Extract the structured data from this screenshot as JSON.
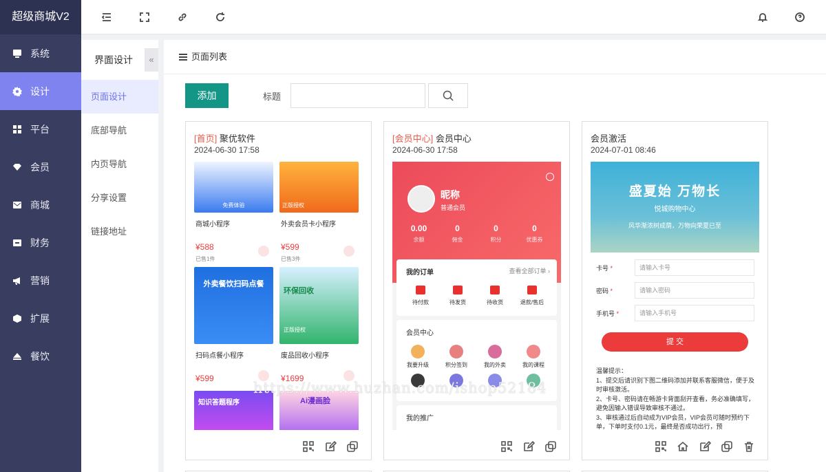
{
  "brand": "超级商城V2",
  "nav": [
    {
      "label": "系统",
      "icon": "monitor-icon",
      "active": false
    },
    {
      "label": "设计",
      "icon": "gear-icon",
      "active": true
    },
    {
      "label": "平台",
      "icon": "grid-icon",
      "active": false
    },
    {
      "label": "会员",
      "icon": "diamond-icon",
      "active": false
    },
    {
      "label": "商城",
      "icon": "mail-icon",
      "active": false
    },
    {
      "label": "财务",
      "icon": "wallet-icon",
      "active": false
    },
    {
      "label": "营销",
      "icon": "megaphone-icon",
      "active": false
    },
    {
      "label": "扩展",
      "icon": "cube-icon",
      "active": false
    },
    {
      "label": "餐饮",
      "icon": "eject-icon",
      "active": false
    }
  ],
  "header_icons": [
    "menu-fold-icon",
    "fullscreen-icon",
    "link-icon",
    "refresh-icon",
    "bell-icon",
    "help-icon"
  ],
  "sub": {
    "title": "界面设计",
    "collapse": "«",
    "items": [
      {
        "label": "页面设计",
        "active": true
      },
      {
        "label": "底部导航",
        "active": false
      },
      {
        "label": "内页导航",
        "active": false
      },
      {
        "label": "分享设置",
        "active": false
      },
      {
        "label": "链接地址",
        "active": false
      }
    ]
  },
  "main": {
    "title": "页面列表",
    "add_label": "添加",
    "search_label": "标题",
    "search_value": ""
  },
  "cards": [
    {
      "tag": "[首页]",
      "name": "聚优软件",
      "date": "2024-06-30 17:58",
      "products": [
        {
          "name": "商城小程序",
          "price": "¥588",
          "sold": "已售1件"
        },
        {
          "name": "外卖会员卡小程序",
          "price": "¥599",
          "sold": "已售3件"
        },
        {
          "name": "扫码点餐小程序",
          "price": "¥599",
          "sold": ""
        },
        {
          "name": "废品回收小程序",
          "price": "¥1699",
          "sold": ""
        }
      ],
      "image_texts": [
        "免费体验",
        "正版授权",
        "外卖餐饮扫码点餐",
        "环保回收",
        "正版授权",
        "知识答题程序",
        "Ai漫画脸"
      ],
      "actions": [
        "qrcode-icon",
        "edit-icon",
        "copy-icon"
      ]
    },
    {
      "tag": "[会员中心]",
      "name": "会员中心",
      "date": "2024-06-30 17:58",
      "member": {
        "nickname": "昵称",
        "level": "普通会员",
        "stats": [
          {
            "value": "0.00",
            "label": "余额"
          },
          {
            "value": "0",
            "label": "佣金"
          },
          {
            "value": "0",
            "label": "积分"
          },
          {
            "value": "0",
            "label": "优惠券"
          }
        ],
        "orders_title": "我的订单",
        "orders_more": "查看全部订单 ›",
        "orders": [
          "待付款",
          "待发货",
          "待收货",
          "退款/售后"
        ],
        "center_title": "会员中心",
        "services": [
          "我要升级",
          "积分签到",
          "我的外卖",
          "我的课程"
        ],
        "promo_title": "我的推广"
      },
      "actions": [
        "qrcode-icon",
        "edit-icon",
        "copy-icon"
      ]
    },
    {
      "tag": "",
      "name": "会员激活",
      "date": "2024-07-01 08:46",
      "banner": {
        "title": "盛夏始 万物长",
        "sub": "悦城购物中心",
        "sub2": "风华渐浓树成荫，万物向荣夏已至"
      },
      "form": [
        {
          "label": "卡号",
          "placeholder": "请输入卡号"
        },
        {
          "label": "密码",
          "placeholder": "请输入密码"
        },
        {
          "label": "手机号",
          "placeholder": "请输入手机号"
        }
      ],
      "submit": "提 交",
      "tips": [
        "温馨提示：",
        "1、提交后请识别下图二维码添加并联系客服微信，便于及时审核激活。",
        "2、卡号、密码请在畅游卡背面刮开查看，务必准确填写，避免因输入错误导致审核不通过。",
        "3、审核通过后自动成为VIP会员，VIP会员可随时预约下单，下单时支付0.1元，最终是否成功出行，预"
      ],
      "actions": [
        "qrcode-icon",
        "home-icon",
        "edit-icon",
        "copy-icon",
        "trash-icon"
      ]
    }
  ],
  "watermark": "https://www.huzhan.com/ishop52184"
}
